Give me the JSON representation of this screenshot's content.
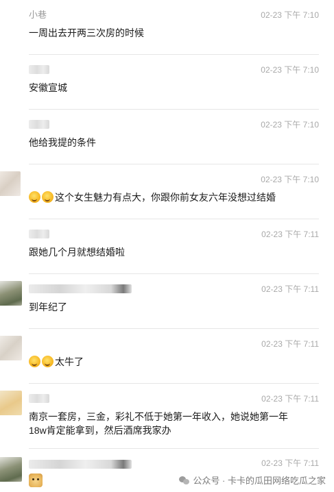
{
  "messages": [
    {
      "name": "小巷",
      "time": "02-23 下午 7:10",
      "text": "一周出去开两三次房的时候",
      "emojis": 0
    },
    {
      "name": "",
      "time": "02-23 下午 7:10",
      "text": "安徽宣城",
      "emojis": 0
    },
    {
      "name": "",
      "time": "02-23 下午 7:10",
      "text": "他给我提的条件",
      "emojis": 0
    },
    {
      "name": "",
      "time": "02-23 下午 7:10",
      "text": "这个女生魅力有点大，你跟你前女友六年没想过结婚",
      "emojis": 2
    },
    {
      "name": "",
      "time": "02-23 下午 7:11",
      "text": "跟她几个月就想结婚啦",
      "emojis": 0
    },
    {
      "name": "",
      "time": "02-23 下午 7:11",
      "text": "到年纪了",
      "emojis": 0
    },
    {
      "name": "",
      "time": "02-23 下午 7:11",
      "text": "太牛了",
      "emojis": 2
    },
    {
      "name": "",
      "time": "02-23 下午 7:11",
      "text": "南京一套房，三金，彩礼不低于她第一年收入，她说她第一年18w肯定能拿到，然后酒席我家办",
      "emojis": 0
    },
    {
      "name": "",
      "time": "02-23 下午 7:11",
      "text": "",
      "emojis": 0,
      "dog_emoji": true
    }
  ],
  "watermark": "公众号 · 卡卡的瓜田网络吃瓜之家",
  "icons": {
    "reaction_emoji": "crying-laughing-emoji-icon",
    "doge": "doge-emoji-icon",
    "watermark": "wechat-icon"
  }
}
